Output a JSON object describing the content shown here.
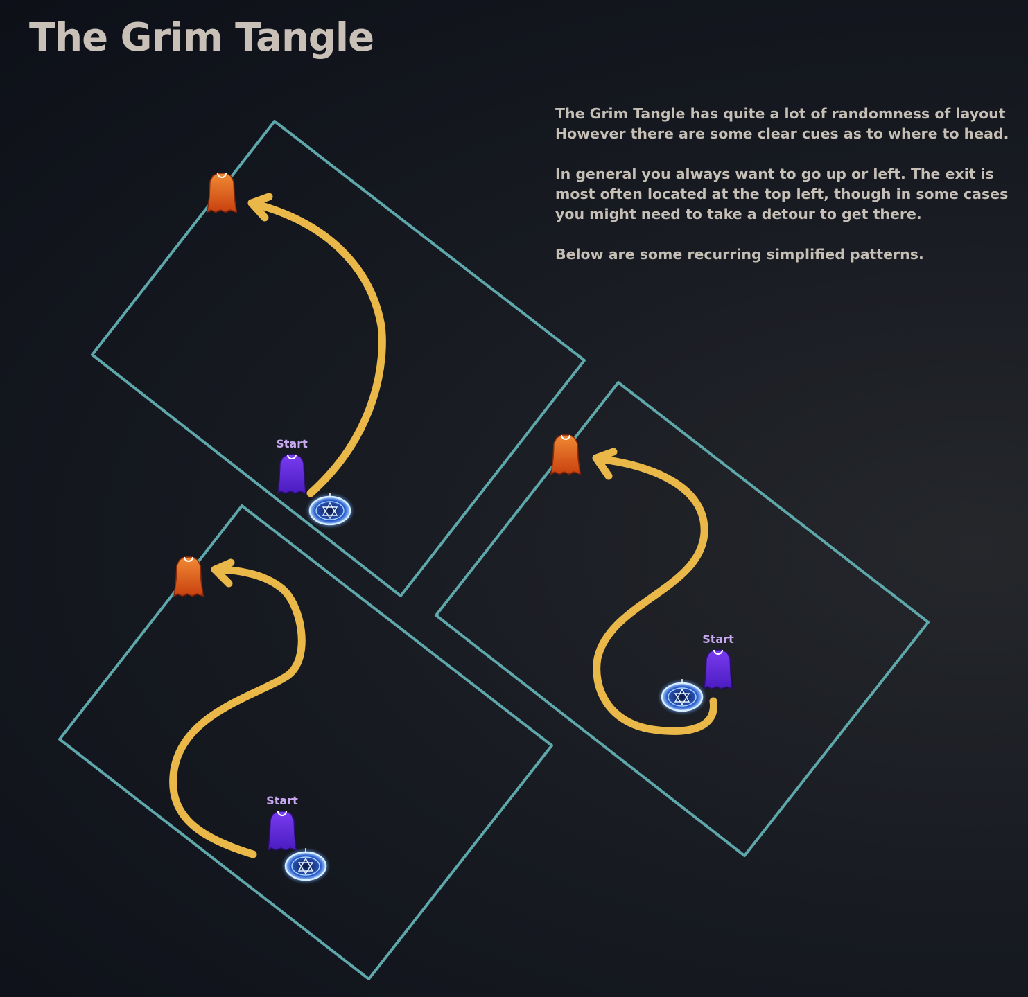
{
  "title": "The Grim Tangle",
  "description": {
    "line1": "The Grim Tangle has quite a lot of randomness of layout",
    "line2": "However there are some clear cues as to where to head.",
    "para2": "In general you always want to go up or left. The exit is most often located at the top left, though in some cases you might need to take a detour to get there.",
    "para3": "Below are some recurring simplified patterns."
  },
  "labels": {
    "start": "Start"
  },
  "colors": {
    "room_outline": "#5ea7ab",
    "route": "#e9b849",
    "exit_marker": "#e0641f",
    "start_marker": "#6a2ee0",
    "portal": "#7fb7ff",
    "title_text": "#c9c1b8",
    "start_label": "#c7a8ef"
  },
  "icons": {
    "exit": "exit-door-icon",
    "start": "start-door-icon",
    "portal": "portal-icon",
    "arrow": "arrow-head-icon"
  }
}
